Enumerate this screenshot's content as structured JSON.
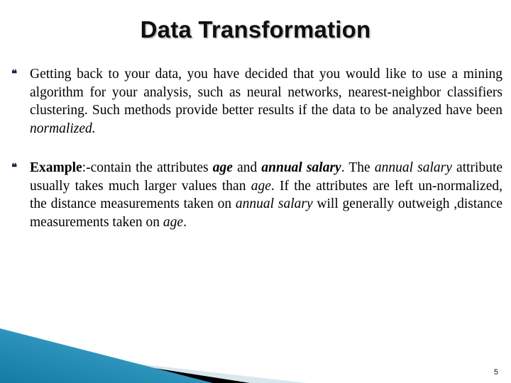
{
  "slide": {
    "title": "Data Transformation",
    "bullet_glyph": "❝",
    "number": "5",
    "colors": {
      "title_text": "#0f0f0f",
      "body_text": "#000000",
      "bullet": "#16213c",
      "teal_dark": "#1b7fa8",
      "teal_light": "#5fb5d6",
      "wedge_black": "#000000",
      "pale_band": "#d9e7ee",
      "background": "#ffffff"
    },
    "bullets": [
      {
        "id": "bullet-getting-back",
        "runs": [
          {
            "text": "Getting back to your data, you have decided that you would like to use a mining algorithm for your analysis, such as neural networks, nearest-neighbor classifiers clustering. Such methods provide better results if the data to be analyzed have been ",
            "style": "normal"
          },
          {
            "text": "normalized",
            "style": "italic"
          },
          {
            "text": ".",
            "style": "italic"
          }
        ]
      },
      {
        "id": "bullet-example",
        "runs": [
          {
            "text": "Example",
            "style": "bold"
          },
          {
            "text": ":-contain the attributes ",
            "style": "normal"
          },
          {
            "text": "age",
            "style": "bold-italic"
          },
          {
            "text": " and ",
            "style": "normal"
          },
          {
            "text": "annual salary",
            "style": "bold-italic"
          },
          {
            "text": ". The ",
            "style": "normal"
          },
          {
            "text": "annual salary",
            "style": "italic"
          },
          {
            "text": " attribute usually takes much larger values than ",
            "style": "normal"
          },
          {
            "text": "age",
            "style": "italic"
          },
          {
            "text": ". If the attributes are left un-normalized, the distance measurements taken on ",
            "style": "normal"
          },
          {
            "text": "annual salary",
            "style": "italic"
          },
          {
            "text": " will generally outweigh ,distance measurements taken on ",
            "style": "normal"
          },
          {
            "text": "age",
            "style": "italic"
          },
          {
            "text": ".",
            "style": "normal"
          }
        ]
      }
    ]
  }
}
